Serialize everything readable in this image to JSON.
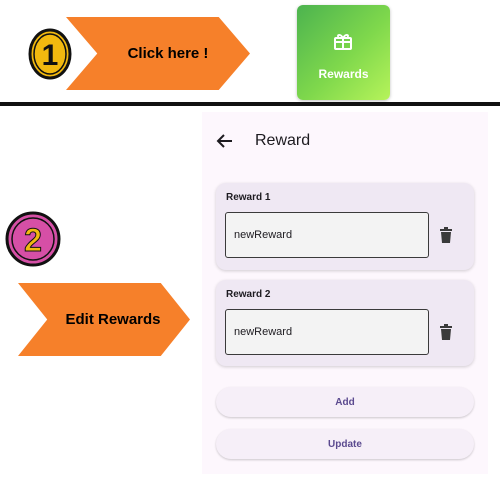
{
  "step1": {
    "number": "1",
    "arrow_label": "Click here !",
    "tile_label": "Rewards",
    "tile_icon": "gift-icon"
  },
  "step2": {
    "number": "2",
    "arrow_label": "Edit Rewards"
  },
  "screen": {
    "title": "Reward",
    "back_icon": "back-arrow-icon",
    "rewards": [
      {
        "label": "Reward 1",
        "value": "newReward"
      },
      {
        "label": "Reward 2",
        "value": "newReward"
      }
    ],
    "add_label": "Add",
    "update_label": "Update"
  },
  "colors": {
    "arrow": "#f6802a",
    "badge1": "#f2b90f",
    "badge2": "#d64fa6",
    "tile_start": "#4cb34f",
    "tile_end": "#b6f35a",
    "button_text": "#5b4a8f"
  }
}
